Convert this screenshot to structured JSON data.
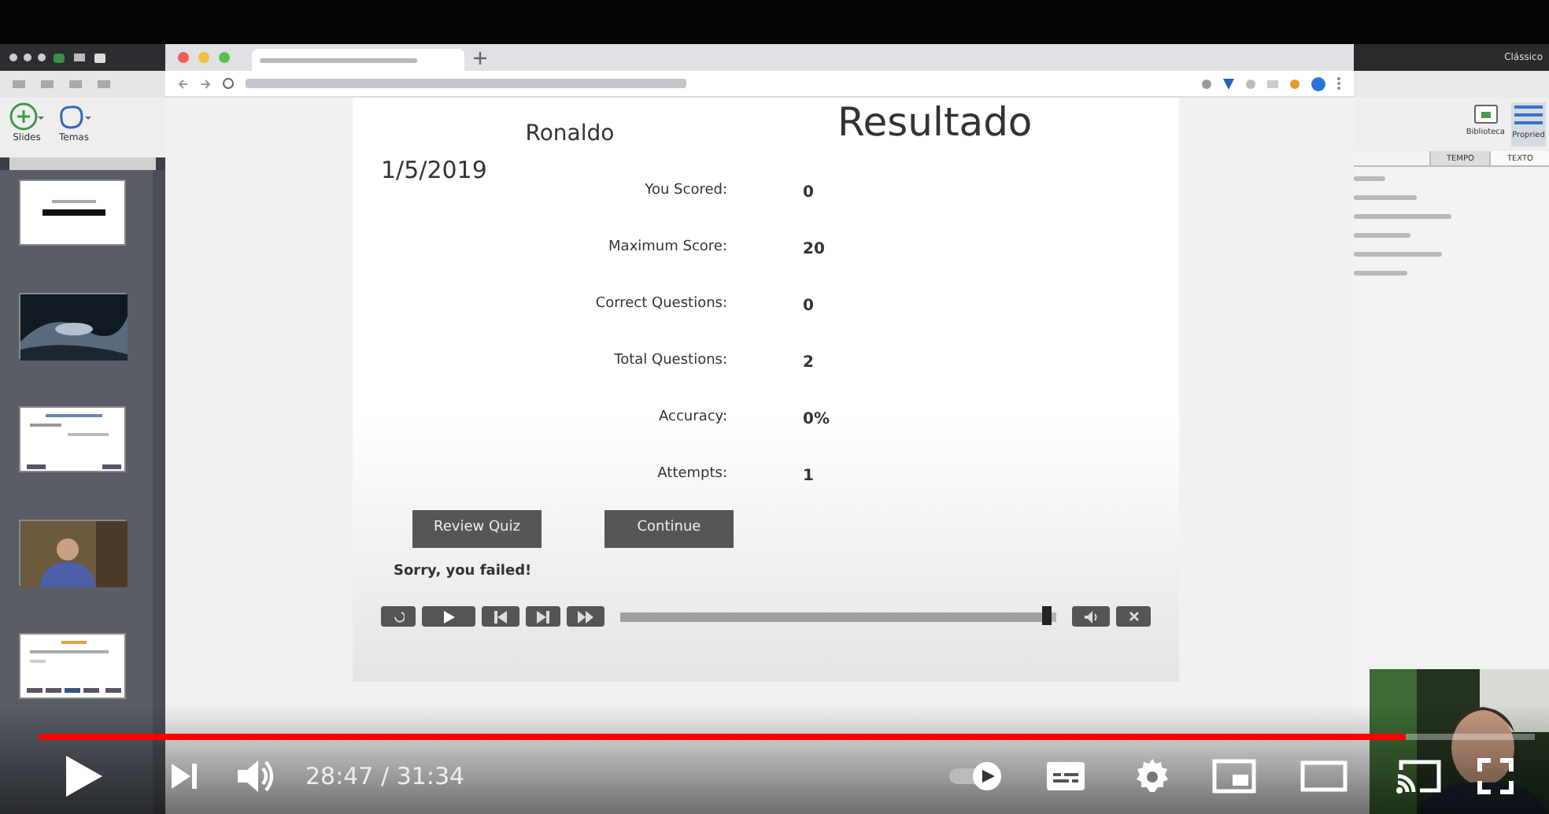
{
  "editor_sidebar": {
    "ribbon_buttons": [
      {
        "label": "Slides"
      },
      {
        "label": "Temas"
      }
    ],
    "thumbnails": [
      {
        "kind": "slide"
      },
      {
        "kind": "picture"
      },
      {
        "kind": "slide"
      },
      {
        "kind": "picture"
      },
      {
        "kind": "slide"
      }
    ]
  },
  "right_panel": {
    "title": "Clássico",
    "buttons": [
      {
        "label": "Biblioteca"
      },
      {
        "label": "Propried"
      }
    ],
    "tabs": [
      {
        "label": "TEMPO",
        "selected": false
      },
      {
        "label": "TEXTO",
        "selected": true
      }
    ]
  },
  "quiz": {
    "name": "Ronaldo",
    "title": "Resultado",
    "date": "1/5/2019",
    "rows": [
      {
        "label": "You Scored:",
        "value": "0"
      },
      {
        "label": "Maximum Score:",
        "value": "20"
      },
      {
        "label": "Correct Questions:",
        "value": "0"
      },
      {
        "label": "Total Questions:",
        "value": "2"
      },
      {
        "label": "Accuracy:",
        "value": "0%"
      },
      {
        "label": "Attempts:",
        "value": "1"
      }
    ],
    "buttons": [
      "Review Quiz",
      "Continue"
    ],
    "message": "Sorry, you failed!",
    "player": {
      "level": 0.98
    }
  },
  "video_player": {
    "level": 0.914,
    "time": "28:47 / 31:34",
    "autoplay": true
  }
}
